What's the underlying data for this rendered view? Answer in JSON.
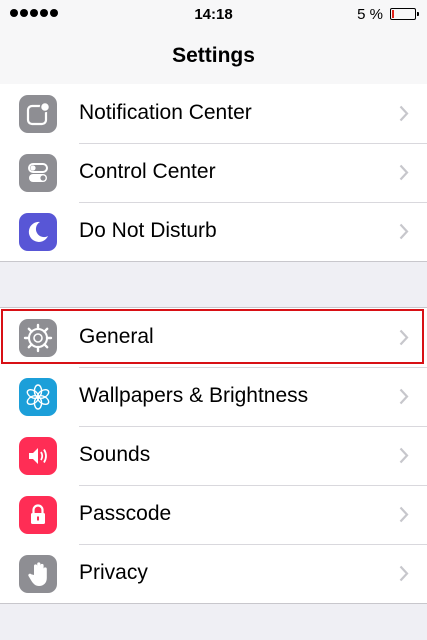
{
  "status_bar": {
    "time": "14:18",
    "battery_text": "5 %"
  },
  "nav": {
    "title": "Settings"
  },
  "groups": [
    {
      "items": [
        {
          "label": "Notification Center",
          "icon": "notification-center-icon",
          "color": "#8e8e93"
        },
        {
          "label": "Control Center",
          "icon": "control-center-icon",
          "color": "#8e8e93"
        },
        {
          "label": "Do Not Disturb",
          "icon": "moon-icon",
          "color": "#5856d6"
        }
      ]
    },
    {
      "items": [
        {
          "label": "General",
          "icon": "gear-icon",
          "color": "#8e8e93"
        },
        {
          "label": "Wallpapers & Brightness",
          "icon": "flower-icon",
          "color": "#1c9fd9"
        },
        {
          "label": "Sounds",
          "icon": "speaker-icon",
          "color": "#ff2d55"
        },
        {
          "label": "Passcode",
          "icon": "lock-icon",
          "color": "#ff2d55"
        },
        {
          "label": "Privacy",
          "icon": "hand-icon",
          "color": "#8e8e93"
        }
      ]
    }
  ],
  "highlight_color": "#d81015"
}
